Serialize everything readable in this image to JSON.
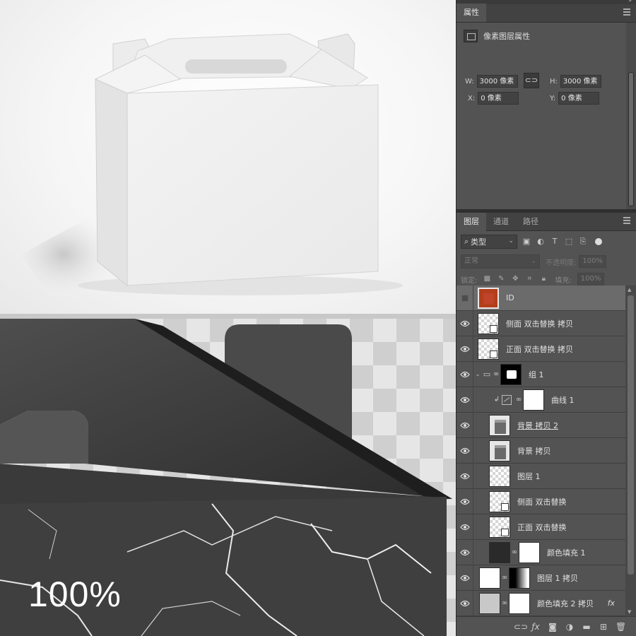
{
  "canvas": {
    "zoom_label": "100%"
  },
  "properties": {
    "tab_label": "属性",
    "subtitle": "像素图层属性",
    "w_label": "W:",
    "w_value": "3000 像素",
    "h_label": "H:",
    "h_value": "3000 像素",
    "x_label": "X:",
    "x_value": "0 像素",
    "y_label": "Y:",
    "y_value": "0 像素"
  },
  "layers_panel": {
    "tabs": [
      "图层",
      "通道",
      "路径"
    ],
    "filter_label": "类型",
    "blend_mode": "正常",
    "opacity_label": "不透明度:",
    "opacity_value": "100%",
    "lock_label": "锁定:",
    "fill_label": "填充:",
    "fill_value": "100%",
    "layers": [
      {
        "name": "ID",
        "visible": false,
        "thumb": "red-fill",
        "selected": true
      },
      {
        "name": "侧面 双击替换 拷贝",
        "visible": true,
        "thumb": "smart-object"
      },
      {
        "name": "正面 双击替换 拷贝",
        "visible": true,
        "thumb": "smart-object"
      },
      {
        "name": "组 1",
        "visible": true,
        "thumb": "group-mask"
      },
      {
        "name": "曲线 1",
        "visible": true,
        "thumb": "curves-adjustment"
      },
      {
        "name": "背景 拷贝 2",
        "visible": true,
        "thumb": "box-image"
      },
      {
        "name": "背景 拷贝",
        "visible": true,
        "thumb": "box-image"
      },
      {
        "name": "图层 1",
        "visible": true,
        "thumb": "white"
      },
      {
        "name": "侧面 双击替换",
        "visible": true,
        "thumb": "smart-object"
      },
      {
        "name": "正面 双击替换",
        "visible": true,
        "thumb": "smart-object"
      },
      {
        "name": "颜色填充 1",
        "visible": true,
        "thumb": "dark-fill"
      },
      {
        "name": "图层 1 拷贝",
        "visible": true,
        "thumb": "mask-gradient"
      },
      {
        "name": "颜色填充 2 拷贝",
        "visible": true,
        "thumb": "gray-fill",
        "fx": "fx"
      }
    ]
  },
  "icons": {
    "eye": "eye-icon",
    "link": "link-icon",
    "folder": "folder-icon",
    "fx": "fx-icon",
    "trash": "trash-icon"
  },
  "colors": {
    "panel_bg": "#535353",
    "selected_row": "#6b6b6b",
    "id_layer": "#b43d1b"
  }
}
